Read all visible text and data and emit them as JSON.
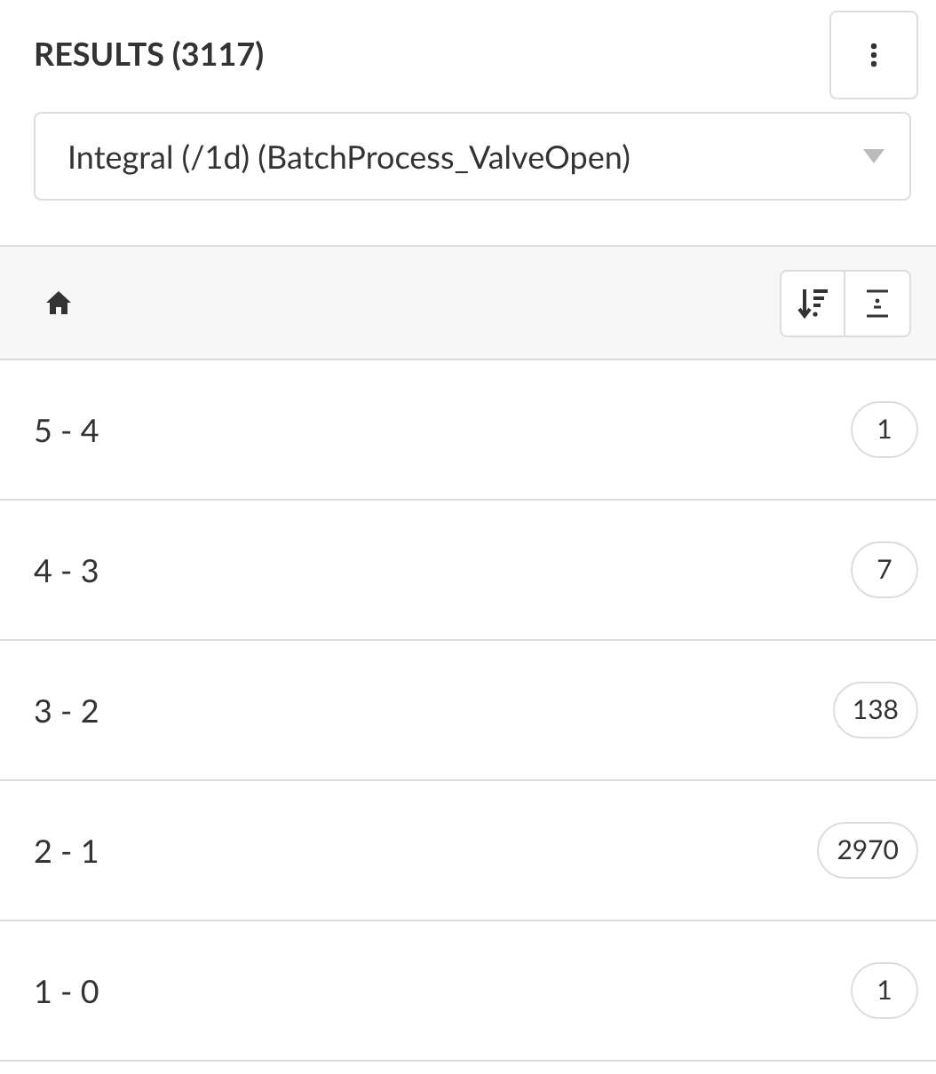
{
  "title": "RESULTS (3117)",
  "dropdown": {
    "value": "Integral (/1d) (BatchProcess_ValveOpen)"
  },
  "rows": [
    {
      "label": "5 - 4",
      "count": "1"
    },
    {
      "label": "4 - 3",
      "count": "7"
    },
    {
      "label": "3 - 2",
      "count": "138"
    },
    {
      "label": "2 - 1",
      "count": "2970"
    },
    {
      "label": "1 - 0",
      "count": "1"
    }
  ]
}
